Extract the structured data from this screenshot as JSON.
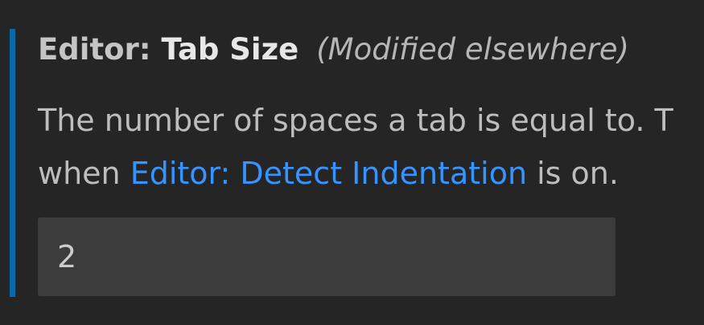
{
  "setting": {
    "category": "Editor: ",
    "label": "Tab Size",
    "modified_indicator": "(Modified elsewhere)",
    "description_line1": "The number of spaces a tab is equal to. T",
    "description_line2_before_link": "when ",
    "description_link": "Editor: Detect Indentation",
    "description_line2_after_link": " is on.",
    "value": "2"
  },
  "colors": {
    "background": "#252526",
    "focus_bar": "#007fd4",
    "link": "#3794ff",
    "input_background": "#3c3c3c"
  }
}
